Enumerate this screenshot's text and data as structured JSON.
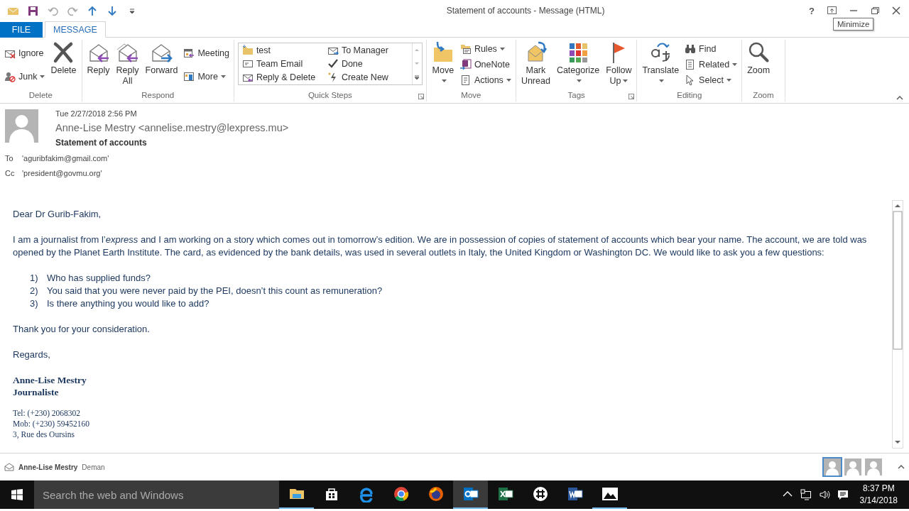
{
  "title_bar": {
    "title": "Statement of accounts - Message (HTML)",
    "help": "?",
    "tooltip": "Minimize"
  },
  "tabs": [
    {
      "label": "FILE",
      "kind": "file",
      "selected": false
    },
    {
      "label": "MESSAGE",
      "kind": "tab",
      "selected": true
    }
  ],
  "ribbon": {
    "groups": [
      {
        "label": "Delete",
        "launcher": false,
        "items": [
          {
            "kind": "stack",
            "items": [
              {
                "label": "Ignore",
                "menu": false
              },
              {
                "label": "Junk",
                "menu": true
              }
            ]
          },
          {
            "kind": "large",
            "label": "Delete",
            "menu": false
          }
        ]
      },
      {
        "label": "Respond",
        "launcher": false,
        "items": [
          {
            "kind": "large",
            "label": "Reply",
            "menu": false
          },
          {
            "kind": "large",
            "label": "Reply All",
            "menu": false
          },
          {
            "kind": "large",
            "label": "Forward",
            "menu": false
          },
          {
            "kind": "stack",
            "items": [
              {
                "label": "Meeting",
                "menu": false
              },
              {
                "label": "More",
                "menu": true
              }
            ]
          }
        ]
      },
      {
        "label": "Quick Steps",
        "launcher": true,
        "items": [
          {
            "kind": "gallery",
            "items": [
              {
                "label": "test"
              },
              {
                "label": "To Manager"
              },
              {
                "label": "Team Email"
              },
              {
                "label": "Done"
              },
              {
                "label": "Reply & Delete"
              },
              {
                "label": "Create New"
              }
            ]
          }
        ]
      },
      {
        "label": "Move",
        "launcher": false,
        "items": [
          {
            "kind": "large",
            "label": "Move",
            "menu": true
          },
          {
            "kind": "stack",
            "items": [
              {
                "label": "Rules",
                "menu": true
              },
              {
                "label": "OneNote",
                "menu": false
              },
              {
                "label": "Actions",
                "menu": true
              }
            ]
          }
        ]
      },
      {
        "label": "Tags",
        "launcher": true,
        "items": [
          {
            "kind": "large",
            "label": "Mark Unread",
            "menu": false
          },
          {
            "kind": "large",
            "label": "Categorize",
            "menu": true
          },
          {
            "kind": "large",
            "label": "Follow Up",
            "menu": true
          }
        ]
      },
      {
        "label": "Editing",
        "launcher": false,
        "items": [
          {
            "kind": "large",
            "label": "Translate",
            "menu": true
          },
          {
            "kind": "stack",
            "items": [
              {
                "label": "Find",
                "menu": false
              },
              {
                "label": "Related",
                "menu": true
              },
              {
                "label": "Select",
                "menu": true
              }
            ]
          }
        ]
      },
      {
        "label": "Zoom",
        "launcher": false,
        "items": [
          {
            "kind": "large",
            "label": "Zoom",
            "menu": false
          }
        ]
      }
    ]
  },
  "header": {
    "date": "Tue 2/27/2018 2:56 PM",
    "sender": "Anne-Lise Mestry <annelise.mestry@lexpress.mu>",
    "subject": "Statement of accounts",
    "recipients": [
      {
        "label": "To",
        "value": "'aguribfakim@gmail.com'"
      },
      {
        "label": "Cc",
        "value": "'president@govmu.org'"
      }
    ]
  },
  "body": {
    "blocks": [
      {
        "kind": "para",
        "text": "Dear Dr Gurib-Fakim,"
      },
      {
        "kind": "para",
        "text": "I am a journalist from l’*express* and I am working on a story which comes out in tomorrow’s edition. We are in possession of copies of statement of accounts which bear your name. The account, we are told was opened by the Planet Earth Institute. The card, as evidenced by the bank details, was used in several outlets in Italy, the United Kingdom or Washington DC. We would like to ask you a few questions:"
      },
      {
        "kind": "list",
        "items": [
          {
            "number": "1)",
            "text": "Who has supplied funds?"
          },
          {
            "number": "2)",
            "text": "You said that you were never paid by the PEI, doesn’t this count as remuneration?"
          },
          {
            "number": "3)",
            "text": "Is there anything you would like to add?"
          }
        ]
      },
      {
        "kind": "para",
        "text": "Thank you for your consideration."
      },
      {
        "kind": "para",
        "text": "Regards,"
      },
      {
        "kind": "signature",
        "lines": [
          "Anne-Lise Mestry",
          "Journaliste"
        ]
      },
      {
        "kind": "contact",
        "lines": [
          "Tel: (+230) 2068302",
          "Mob: (+230) 59452160",
          "3, Rue des Oursins"
        ]
      }
    ]
  },
  "people_pane": {
    "name": "Anne-Lise Mestry",
    "snippet": "Deman",
    "avatars": [
      {
        "selected": true
      },
      {
        "selected": false
      },
      {
        "selected": false
      }
    ]
  },
  "taskbar": {
    "search_placeholder": "Search the web and Windows",
    "apps": [
      {
        "running": true,
        "selected": false
      },
      {
        "running": false,
        "selected": false
      },
      {
        "running": false,
        "selected": false
      },
      {
        "running": false,
        "selected": false
      },
      {
        "running": false,
        "selected": false
      },
      {
        "running": true,
        "selected": true
      },
      {
        "running": false,
        "selected": false
      },
      {
        "running": false,
        "selected": false
      },
      {
        "running": false,
        "selected": false
      },
      {
        "running": true,
        "selected": false
      }
    ],
    "time": "8:37 PM",
    "date": "3/14/2018"
  }
}
